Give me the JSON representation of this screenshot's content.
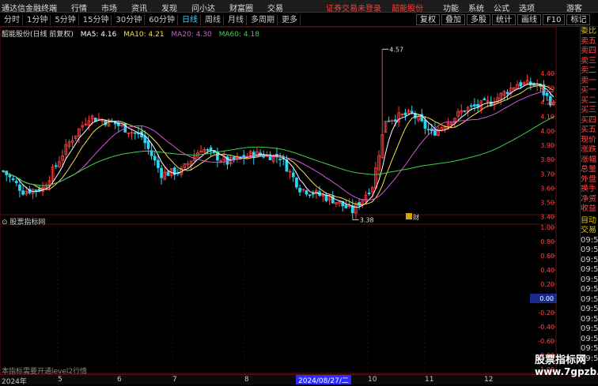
{
  "titlebar": {
    "app_name": "通达信金融终端",
    "menus": [
      "行情",
      "市场",
      "资讯",
      "发现",
      "问小达",
      "财富圈",
      "交易"
    ],
    "notice": "证券交易未登录",
    "stock_link": "韶能股份",
    "right_menus": [
      "功能",
      "系统",
      "公式",
      "选项"
    ],
    "guest": "游客"
  },
  "periods": [
    "分时",
    "1分钟",
    "5分钟",
    "15分钟",
    "30分钟",
    "60分钟",
    "日线",
    "周线",
    "月线",
    "多周期",
    "更多"
  ],
  "active_period": "日线",
  "tools": [
    "复权",
    "叠加",
    "多股",
    "统计",
    "画线",
    "F10",
    "标记"
  ],
  "main_chart": {
    "name": "韶能股份(日线 前复权)",
    "ma": [
      {
        "label": "MA5: 4.16",
        "color": "#ffffff"
      },
      {
        "label": "MA10: 4.21",
        "color": "#f4e04d"
      },
      {
        "label": "MA20: 4.30",
        "color": "#d35ad8"
      },
      {
        "label": "MA60: 4.18",
        "color": "#3ed14a"
      }
    ],
    "high_label": "4.57",
    "low_label": "3.38",
    "badge": "财"
  },
  "y_axis": [
    "4.40",
    "4.30",
    "4.20",
    "4.10",
    "4.00",
    "3.90",
    "3.80",
    "3.70",
    "3.60",
    "3.50",
    "3.40"
  ],
  "indicator": {
    "title": "股票指标网",
    "note": "本指标需要开通level2行情",
    "y_axis": [
      "1.00",
      "0.80",
      "0.60",
      "0.40",
      "0.20",
      "0.00",
      "-0.20",
      "-0.40",
      "-0.60",
      "-0.80",
      "-1.00"
    ],
    "zero_value": "0.00"
  },
  "right_panel": {
    "quote_items": [
      "委比",
      "卖五",
      "卖四",
      "卖三",
      "卖二",
      "卖一",
      "买一",
      "买二",
      "买三",
      "买四",
      "买五",
      "现价",
      "涨跌",
      "涨幅",
      "总量",
      "外盘",
      "换手",
      "净资",
      "收益"
    ],
    "trade_header": [
      "自动",
      "交易"
    ],
    "times": [
      "09:55",
      "09:55",
      "09:55",
      "09:55",
      "09:55",
      "09:55",
      "09:55",
      "09:55",
      "09:55",
      "09:55",
      "09:55",
      "09:55",
      "09:55"
    ],
    "zero_badge": "0.00"
  },
  "x_axis": {
    "labels": [
      "2024年",
      "5",
      "6",
      "7",
      "8",
      "10",
      "11",
      "12"
    ],
    "cursor_date": "2024/08/27/二"
  },
  "watermark": {
    "name": "股票指标网",
    "url": "www.7gpzb.com"
  },
  "colors": {
    "up": "#ff3c3c",
    "down": "#2ad4f2",
    "ma5": "#ffffff",
    "ma10": "#f4e04d",
    "ma20": "#d35ad8",
    "ma60": "#3ed14a",
    "grid": "#5a1010"
  }
}
